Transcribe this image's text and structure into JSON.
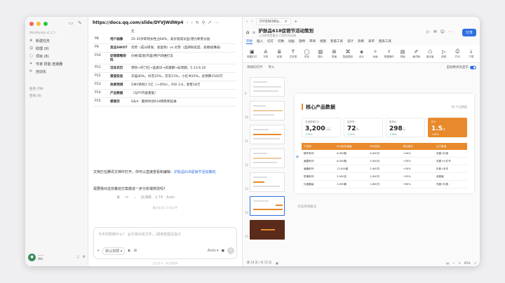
{
  "sidebar": {
    "brand": "WorkBuddy v1.1.5",
    "items": [
      {
        "icon": "new-task-icon",
        "label": "新建任务"
      },
      {
        "icon": "assistant-icon",
        "label": "助理 (9)"
      },
      {
        "icon": "project-icon",
        "label": "项目 (8)"
      },
      {
        "icon": "expert-icon",
        "label": "专家·技能·连接器"
      },
      {
        "icon": "automation-icon",
        "label": "自动化"
      }
    ],
    "tasks_label": "任务 (78)",
    "workspace_label": "空间 (4)",
    "user_name": "——",
    "user_sub": "Nlik"
  },
  "chat": {
    "url": "https://docs.qq.com/slide/DYVJWdWp4WHRqWVV...",
    "table": [
      {
        "page": "",
        "item": "",
        "desc": "元"
      },
      {
        "page": "P8",
        "item": "用户画像",
        "desc": "25-35岁职场女性占68%；高价值成长型/潜力新客分层"
      },
      {
        "page": "P9",
        "item": "竞品SWOT",
        "desc": "优势（成分研发、高复购）vs 劣势（品牌知名度、高端线薄弱）"
      },
      {
        "page": "P10",
        "item": "促销策略矩阵",
        "desc": "价格/渠道/内容/用户四维打法"
      },
      {
        "page": "P11",
        "item": "活动日历",
        "desc": "预热→开门红→品类日→高潮期→返场期，5.13-6.20"
      },
      {
        "page": "P12",
        "item": "渠道投放",
        "desc": "天猫40%，抖音35%，京东15%，小红书10%，总预算1500万"
      },
      {
        "page": "P13",
        "item": "效果预测",
        "desc": "GMV目标1.5亿（+45%），ROI 3.6，新客18万"
      },
      {
        "page": "P14",
        "item": "产品数据",
        "desc": "（与P7内容重复）"
      },
      {
        "page": "P15",
        "item": "感谢页",
        "desc": "Q&A · 期待共创618销售新纪录"
      }
    ],
    "msg1_prefix": "文档已在腾讯文档中打开，你可以直接查看和编辑：",
    "msg1_link": "护肤品618促销节活动策划",
    "msg2": "需要我对这份策划方案做进一步分析或修改吗？",
    "react_model": "Auto",
    "react_time": "2.74",
    "react_extra": "此消耗",
    "separator": "最后出现 13 条文件",
    "input_placeholder": "今天你想做什么？ @引用对话文件，/调用技能及指令",
    "default_perm": "默认权限",
    "mode": "Auto",
    "footnote": "已生成 AI，请注意核对"
  },
  "doc": {
    "tab_label": "DYVJWdWp...",
    "title": "护肤品618促销节活动策划",
    "subtitle": "上次修改是最近 已保存到云端",
    "share": "分享",
    "menu": [
      "开始",
      "插入",
      "幻灯",
      "切换",
      "动画",
      "放映",
      "审阅",
      "视图",
      "智能工具",
      "设计",
      "效果",
      "表单",
      "图表工具"
    ],
    "ribbon": [
      "新建幻灯",
      "字体",
      "段落",
      "文本框",
      "形状",
      "图片",
      "表格",
      "智能图形",
      "设计",
      "动画",
      "快捷操作",
      "排版",
      "格式刷",
      "演讲者",
      "放映",
      "打印",
      "下载"
    ],
    "add_slide": "添加幻灯片",
    "import": "导入",
    "smart_format": "自动格式化显示",
    "slide_title": "核心产品数据",
    "slide_tag": "05 产品数据",
    "cards": [
      {
        "label": "总销售额(万)",
        "value": "3,200",
        "unit": "万元",
        "delta": "+35%"
      },
      {
        "label": "复购率",
        "value": "72",
        "unit": "%",
        "delta": "+12%"
      },
      {
        "label": "客单价",
        "value": "298",
        "unit": "元",
        "delta": "+18%"
      },
      {
        "label": "ROI",
        "value": "1.5",
        "unit": "亿",
        "delta": "+45%"
      }
    ],
    "table_headers": [
      "产品线",
      "618目标销量",
      "618目标",
      "同比增长",
      "主力渠道"
    ],
    "table_rows": [
      [
        "精华系列",
        "8,000瓶",
        "4,000万",
        "+40%",
        "天猫+抖音"
      ],
      [
        "面霜系列",
        "6,500瓶",
        "3,300万",
        "+35%",
        "天猫+小红书"
      ],
      [
        "面膜系列",
        "12,000盒",
        "2,400万",
        "+50%",
        "抖音+京东"
      ],
      [
        "防晒系列",
        "5,000支",
        "2,000万",
        "+55%",
        "全渠道"
      ],
      [
        "礼盒套装",
        "2,000套",
        "1,800万",
        "+60%",
        "天猫+抖音"
      ]
    ],
    "notes_placeholder": "点击添加备注",
    "page_status": "第 14 页 / 共 15 页",
    "zoom": "85%",
    "thumb_numbers": [
      "9",
      "10",
      "11",
      "12",
      "13",
      "14",
      "15"
    ]
  }
}
